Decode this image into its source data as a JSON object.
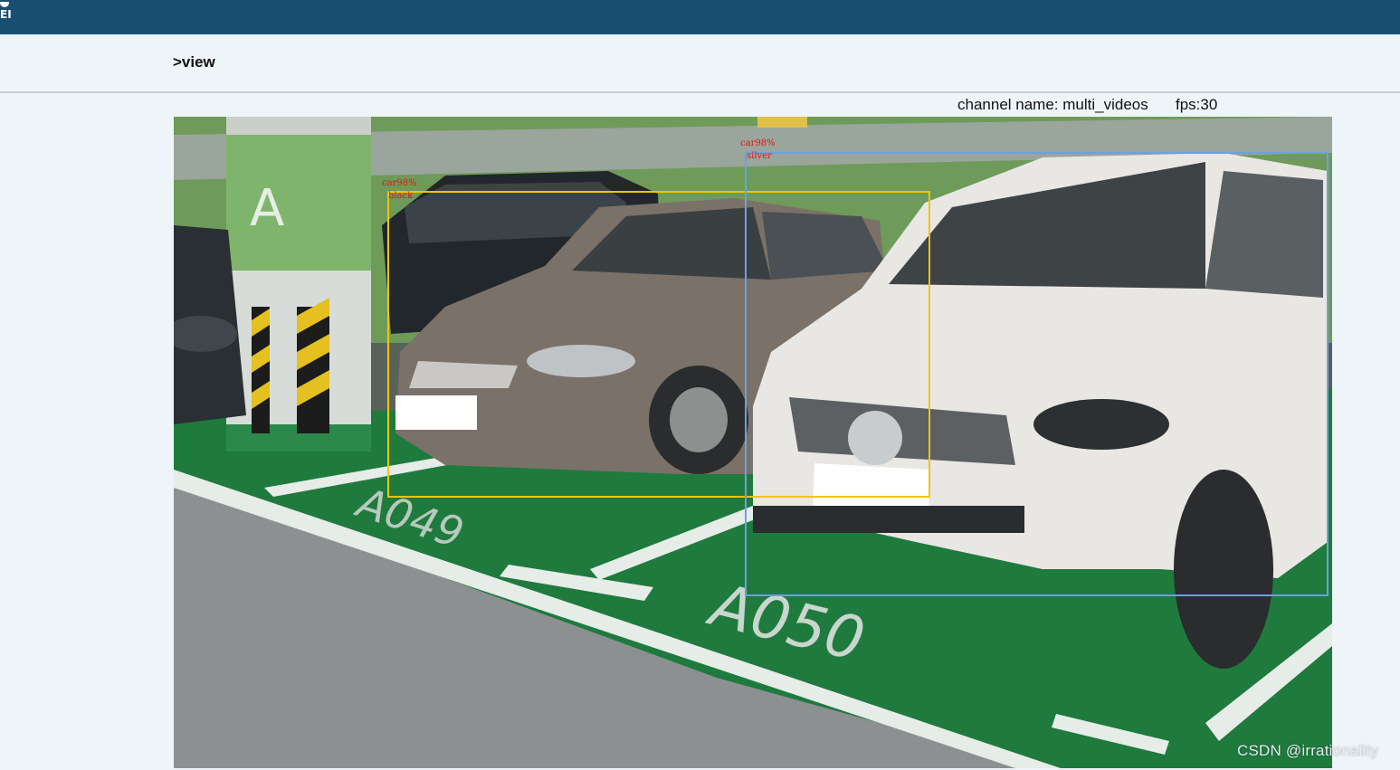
{
  "header": {
    "logo_text": "EI"
  },
  "breadcrumb": {
    "label": ">view"
  },
  "stream": {
    "channel_text": "channel name: multi_videos",
    "fps_text": "fps:30"
  },
  "video": {
    "floor_labels": [
      "A049",
      "A050"
    ],
    "pillar_letter": "A",
    "detections": [
      {
        "class_text": "car98%",
        "color_text": "black",
        "box_color": "#f2c40c"
      },
      {
        "class_text": "car98%",
        "color_text": "silver",
        "box_color": "#6f9fe0"
      }
    ]
  },
  "watermark": {
    "text": "CSDN @irrationality"
  }
}
